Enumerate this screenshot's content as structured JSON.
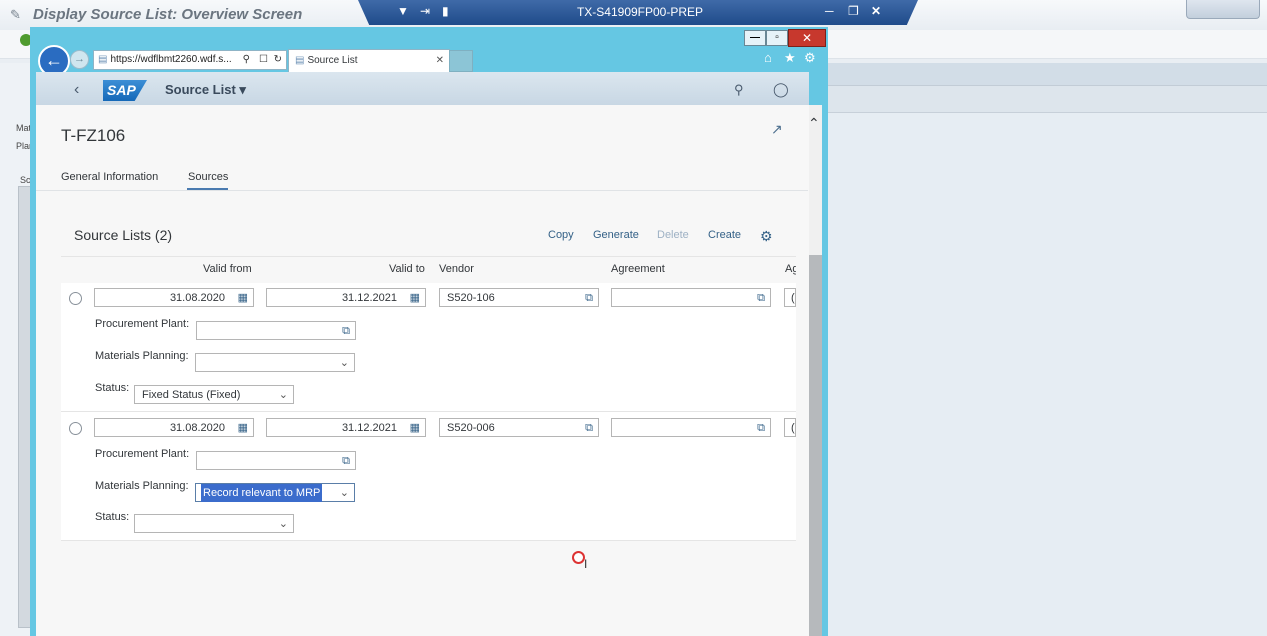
{
  "background": {
    "title": "Display Source List: Overview Screen",
    "labels": [
      "Mat",
      "Plan",
      "Sc"
    ]
  },
  "rdp": {
    "title": "TX-S41909FP00-PREP"
  },
  "browser": {
    "url": "https://wdflbmt2260.wdf.s...",
    "tab_title": "Source List",
    "close_label": "✕",
    "min_label": "—",
    "max_label": "▫"
  },
  "shell": {
    "logo": "SAP",
    "title": "Source List ▾"
  },
  "object": {
    "title": "T-FZ106",
    "tabs": [
      {
        "label": "General Information"
      },
      {
        "label": "Sources"
      }
    ]
  },
  "section": {
    "title": "Source Lists (2)",
    "actions": {
      "copy": "Copy",
      "generate": "Generate",
      "delete": "Delete",
      "create": "Create"
    }
  },
  "columns": {
    "valid_from": "Valid from",
    "valid_to": "Valid to",
    "vendor": "Vendor",
    "agreement": "Agreement",
    "extra": "Ag"
  },
  "labels": {
    "procurement_plant": "Procurement Plant:",
    "materials_planning": "Materials Planning:",
    "status": "Status:"
  },
  "rows": [
    {
      "valid_from": "31.08.2020",
      "valid_to": "31.12.2021",
      "vendor": "S520-106",
      "agreement": "",
      "extra": "(",
      "procurement_plant": "",
      "materials_planning": "",
      "status": "Fixed Status (Fixed)"
    },
    {
      "valid_from": "31.08.2020",
      "valid_to": "31.12.2021",
      "vendor": "S520-006",
      "agreement": "",
      "extra": "(",
      "procurement_plant": "",
      "materials_planning": "Record relevant to MRP",
      "status": ""
    }
  ],
  "colors": {
    "accent": "#346187",
    "browser_frame": "#65c7e3",
    "sap_blue": "#1468b8",
    "selection": "#3b6ccc"
  }
}
